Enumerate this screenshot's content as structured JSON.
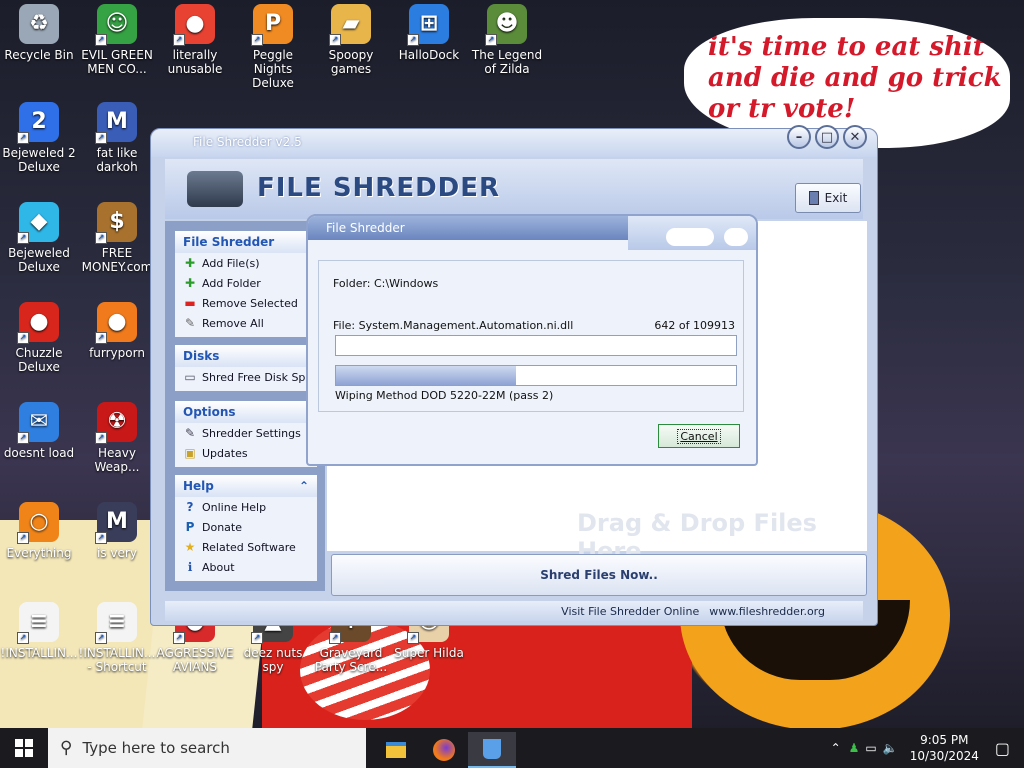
{
  "desktop": {
    "bubble_lines": [
      "it's time to eat shit",
      "and die and go trick",
      "or tr     vote!"
    ],
    "icons": [
      {
        "label": "Recycle Bin",
        "icon": "recycle-bin-icon",
        "color": "#9aa7b6",
        "glyph": "♻"
      },
      {
        "label": "EVIL GREEN MEN CO...",
        "icon": "evil-green-men-icon",
        "color": "#35a244",
        "glyph": "☺"
      },
      {
        "label": "literally unusable",
        "icon": "chrome-icon",
        "color": "#e84233",
        "glyph": "●"
      },
      {
        "label": "Peggle Nights Deluxe",
        "icon": "peggle-icon",
        "color": "#f08a22",
        "glyph": "P"
      },
      {
        "label": "Spoopy games",
        "icon": "folder-icon",
        "color": "#e8b54a",
        "glyph": "▰"
      },
      {
        "label": "HalloDock",
        "icon": "windows-logo-icon",
        "color": "#2b7de0",
        "glyph": "⊞"
      },
      {
        "label": "The Legend of Zilda",
        "icon": "zilda-icon",
        "color": "#5a8c3a",
        "glyph": "☻"
      },
      {
        "label": "Bejeweled 2 Deluxe",
        "icon": "bejeweled2-icon",
        "color": "#2f6fe8",
        "glyph": "2"
      },
      {
        "label": "fat like darkoh",
        "icon": "mpl-icon",
        "color": "#3a5db8",
        "glyph": "M"
      },
      {
        "label": "Bejeweled Deluxe",
        "icon": "gem-icon",
        "color": "#2fb7e8",
        "glyph": "◆"
      },
      {
        "label": "FREE MONEY.com",
        "icon": "money-bag-icon",
        "color": "#a8722e",
        "glyph": "$"
      },
      {
        "label": "Chuzzle Deluxe",
        "icon": "chuzzle-icon",
        "color": "#d8261c",
        "glyph": "●"
      },
      {
        "label": "furryporn",
        "icon": "firefox-icon",
        "color": "#f07a1c",
        "glyph": "●"
      },
      {
        "label": "doesnt load",
        "icon": "thunderbird-icon",
        "color": "#2f7fe0",
        "glyph": "✉"
      },
      {
        "label": "Heavy Weap...",
        "icon": "radiation-icon",
        "color": "#c81818",
        "glyph": "☢"
      },
      {
        "label": "Everything",
        "icon": "everything-search-icon",
        "color": "#f08418",
        "glyph": "○"
      },
      {
        "label": "is very",
        "icon": "mpl-icon",
        "color": "#3a3d5a",
        "glyph": "M"
      },
      {
        "label": "!INSTALLIN...",
        "icon": "text-file-icon",
        "color": "#f4f4f4",
        "glyph": "≡"
      },
      {
        "label": "!INSTALLIN... - Shortcut",
        "icon": "text-file-icon",
        "color": "#f4f4f4",
        "glyph": "≡"
      },
      {
        "label": "AGGRESSIVE AVIANS",
        "icon": "angry-bird-icon",
        "color": "#d82a2a",
        "glyph": "●"
      },
      {
        "label": "deez nuts spy",
        "icon": "spy-icon",
        "color": "#444",
        "glyph": "▲"
      },
      {
        "label": "Graveyard Party Scre...",
        "icon": "graveyard-icon",
        "color": "#6a4a2a",
        "glyph": "✝"
      },
      {
        "label": "Super Hilda",
        "icon": "hilda-icon",
        "color": "#e8d0a8",
        "glyph": "☺"
      }
    ]
  },
  "window": {
    "title": "File Shredder v2.5",
    "logo_text": "FILE SHREDDER",
    "exit_label": "Exit",
    "panels": {
      "file": {
        "title": "File Shredder",
        "items": [
          "Add File(s)",
          "Add Folder",
          "Remove Selected",
          "Remove All"
        ]
      },
      "disks": {
        "title": "Disks",
        "items": [
          "Shred Free Disk Space"
        ]
      },
      "options": {
        "title": "Options",
        "items": [
          "Shredder Settings",
          "Updates"
        ]
      },
      "help": {
        "title": "Help",
        "items": [
          "Online Help",
          "Donate",
          "Related Software",
          "About"
        ]
      }
    },
    "drag_hint": "Drag & Drop Files Here",
    "shred_button": "Shred Files Now..",
    "footer_text": "Visit File Shredder Online",
    "footer_url": "www.fileshredder.org"
  },
  "dialog": {
    "title": "File Shredder",
    "folder": "Folder: C:\\Windows",
    "file": "File: System.Management.Automation.ni.dll",
    "count": "642  of  109913",
    "progress_file": 0.0,
    "progress_pass": 0.45,
    "method": "Wiping Method DOD 5220-22M  (pass 2)",
    "cancel_label": "Cancel"
  },
  "taskbar": {
    "search_placeholder": "Type here to search",
    "time": "9:05 PM",
    "date": "10/30/2024"
  }
}
